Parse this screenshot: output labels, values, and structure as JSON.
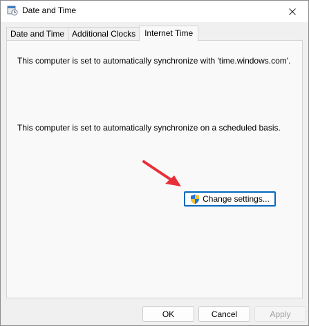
{
  "window": {
    "title": "Date and Time",
    "icon": "clock-calendar-icon"
  },
  "tabs": [
    {
      "label": "Date and Time",
      "active": false
    },
    {
      "label": "Additional Clocks",
      "active": false
    },
    {
      "label": "Internet Time",
      "active": true
    }
  ],
  "internet_time": {
    "sync_server_text": "This computer is set to automatically synchronize with 'time.windows.com'.",
    "schedule_text": "This computer is set to automatically synchronize on a scheduled basis.",
    "change_settings_label": "Change settings...",
    "change_settings_icon": "uac-shield-icon"
  },
  "footer": {
    "ok_label": "OK",
    "cancel_label": "Cancel",
    "apply_label": "Apply",
    "apply_disabled": true
  },
  "annotation": {
    "arrow_color": "#e8303a"
  },
  "colors": {
    "accent": "#0067c0",
    "dialog_bg": "#f0f0f0",
    "panel_bg": "#f9f9f9"
  }
}
